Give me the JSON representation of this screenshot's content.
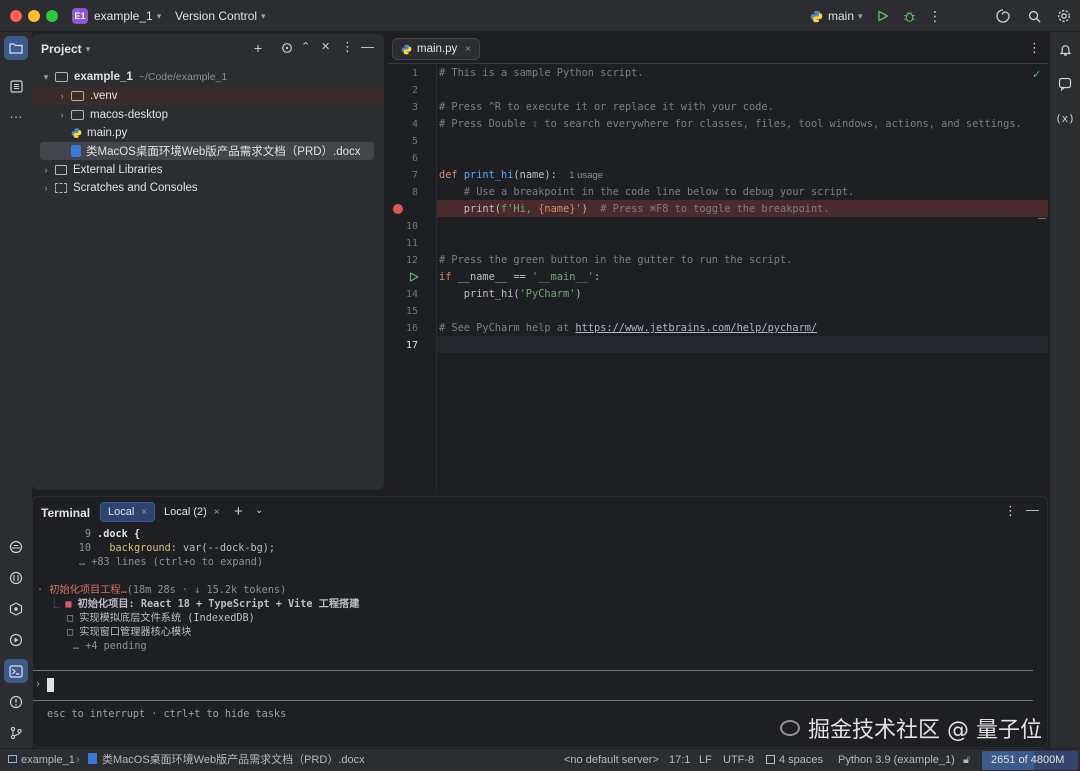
{
  "titlebar": {
    "project_badge": "E1",
    "project_name": "example_1",
    "vcs_label": "Version Control",
    "branch": "main"
  },
  "project_panel": {
    "title": "Project",
    "tree": [
      {
        "label": "example_1",
        "suffix": "~/Code/example_1",
        "type": "folder",
        "expanded": true,
        "level": 0
      },
      {
        "label": ".venv",
        "type": "folder",
        "level": 1
      },
      {
        "label": "macos-desktop",
        "type": "folder",
        "level": 1
      },
      {
        "label": "main.py",
        "type": "python",
        "level": 1
      },
      {
        "label": "类MacOS桌面环境Web版产品需求文档（PRD）.docx",
        "type": "docx",
        "level": 1,
        "selected": true
      },
      {
        "label": "External Libraries",
        "type": "library",
        "level": 0
      },
      {
        "label": "Scratches and Consoles",
        "type": "scratch",
        "level": 0
      }
    ]
  },
  "editor": {
    "tab_label": "main.py",
    "line_numbers": [
      "1",
      "2",
      "3",
      "4",
      "5",
      "6",
      "7",
      "8",
      "9",
      "10",
      "11",
      "12",
      "13",
      "14",
      "15",
      "16",
      "17"
    ],
    "lines": {
      "l1": "# This is a sample Python script.",
      "l3": "# Press ^R to execute it or replace it with your code.",
      "l4": "# Press Double ⇧ to search everywhere for classes, files, tool windows, actions, and settings.",
      "l7_kw": "def ",
      "l7_fn": "print_hi",
      "l7_rest": "(name):",
      "l7_usage": "1 usage",
      "l8": "    # Use a breakpoint in the code line below to debug your script.",
      "l9_a": "    print(",
      "l9_b": "f'Hi, ",
      "l9_c": "{name}",
      "l9_d": "'",
      "l9_e": ")",
      "l9_f": "  # Press ⌘F8 to toggle the breakpoint.",
      "l12": "# Press the green button in the gutter to run the script.",
      "l13_kw": "if ",
      "l13_a": "__name__ == ",
      "l13_str": "'__main__'",
      "l13_b": ":",
      "l14_a": "    print_hi(",
      "l14_str": "'PyCharm'",
      "l14_b": ")",
      "l16_a": "# See PyCharm help at ",
      "l16_link": "https://www.jetbrains.com/help/pycharm/"
    }
  },
  "terminal": {
    "title": "Terminal",
    "tabs": [
      {
        "label": "Local",
        "active": true
      },
      {
        "label": "Local (2)",
        "active": false
      }
    ],
    "lines": {
      "t1_no": "9",
      "t1": ".dock {",
      "t2_no": "10",
      "t2_prop": "background",
      "t2_rest": ": var(--dock-bg);",
      "t3": "… +83 lines (ctrl+o to expand)",
      "t4_title": "初始化项目工程…",
      "t4_meta": "(18m 28s · ↓ 15.2k tokens)",
      "t5": "初始化项目: React 18 + TypeScript + Vite 工程搭建",
      "t6": "实现模拟底层文件系统 (IndexedDB)",
      "t7": "实现窗口管理器核心模块",
      "t8": "… +4 pending",
      "prompt": "›",
      "hint": "esc to interrupt · ctrl+t to hide tasks"
    }
  },
  "status_bar": {
    "project": "example_1",
    "file": "类MacOS桌面环境Web版产品需求文档（PRD）.docx",
    "server": "<no default server>",
    "position": "17:1",
    "line_sep": "LF",
    "encoding": "UTF-8",
    "indent": "4 spaces",
    "interpreter": "Python 3.9 (example_1)",
    "memory": "2651 of 4800M"
  },
  "watermark": "掘金技术社区 @ 量子位",
  "colors": {
    "accent": "#3d5a8a",
    "breakpoint": "#e05555",
    "run": "#5fb865"
  }
}
